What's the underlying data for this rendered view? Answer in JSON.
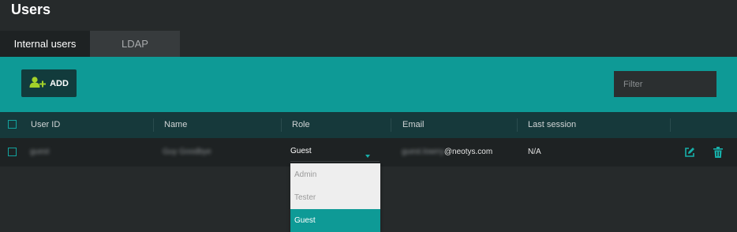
{
  "page": {
    "title": "Users"
  },
  "tabs": [
    {
      "label": "Internal users",
      "active": true
    },
    {
      "label": "LDAP",
      "active": false
    }
  ],
  "toolbar": {
    "add_label": "ADD",
    "filter_placeholder": "Filter"
  },
  "table": {
    "columns": [
      "User ID",
      "Name",
      "Role",
      "Email",
      "Last session"
    ],
    "rows": [
      {
        "user_id": "guest",
        "name": "Guy Goodbye",
        "role": "Guest",
        "email_prefix": "guest.lowrry",
        "email_domain": "@neotys.com",
        "last_session": "N/A"
      }
    ]
  },
  "role_dropdown": {
    "options": [
      "Admin",
      "Tester",
      "Guest"
    ],
    "selected": "Guest"
  },
  "colors": {
    "accent": "#0e9a96",
    "header": "#16393b",
    "background": "#262a2b"
  },
  "icons": {
    "add": "add-user-icon",
    "edit": "edit-icon",
    "delete": "trash-icon"
  }
}
